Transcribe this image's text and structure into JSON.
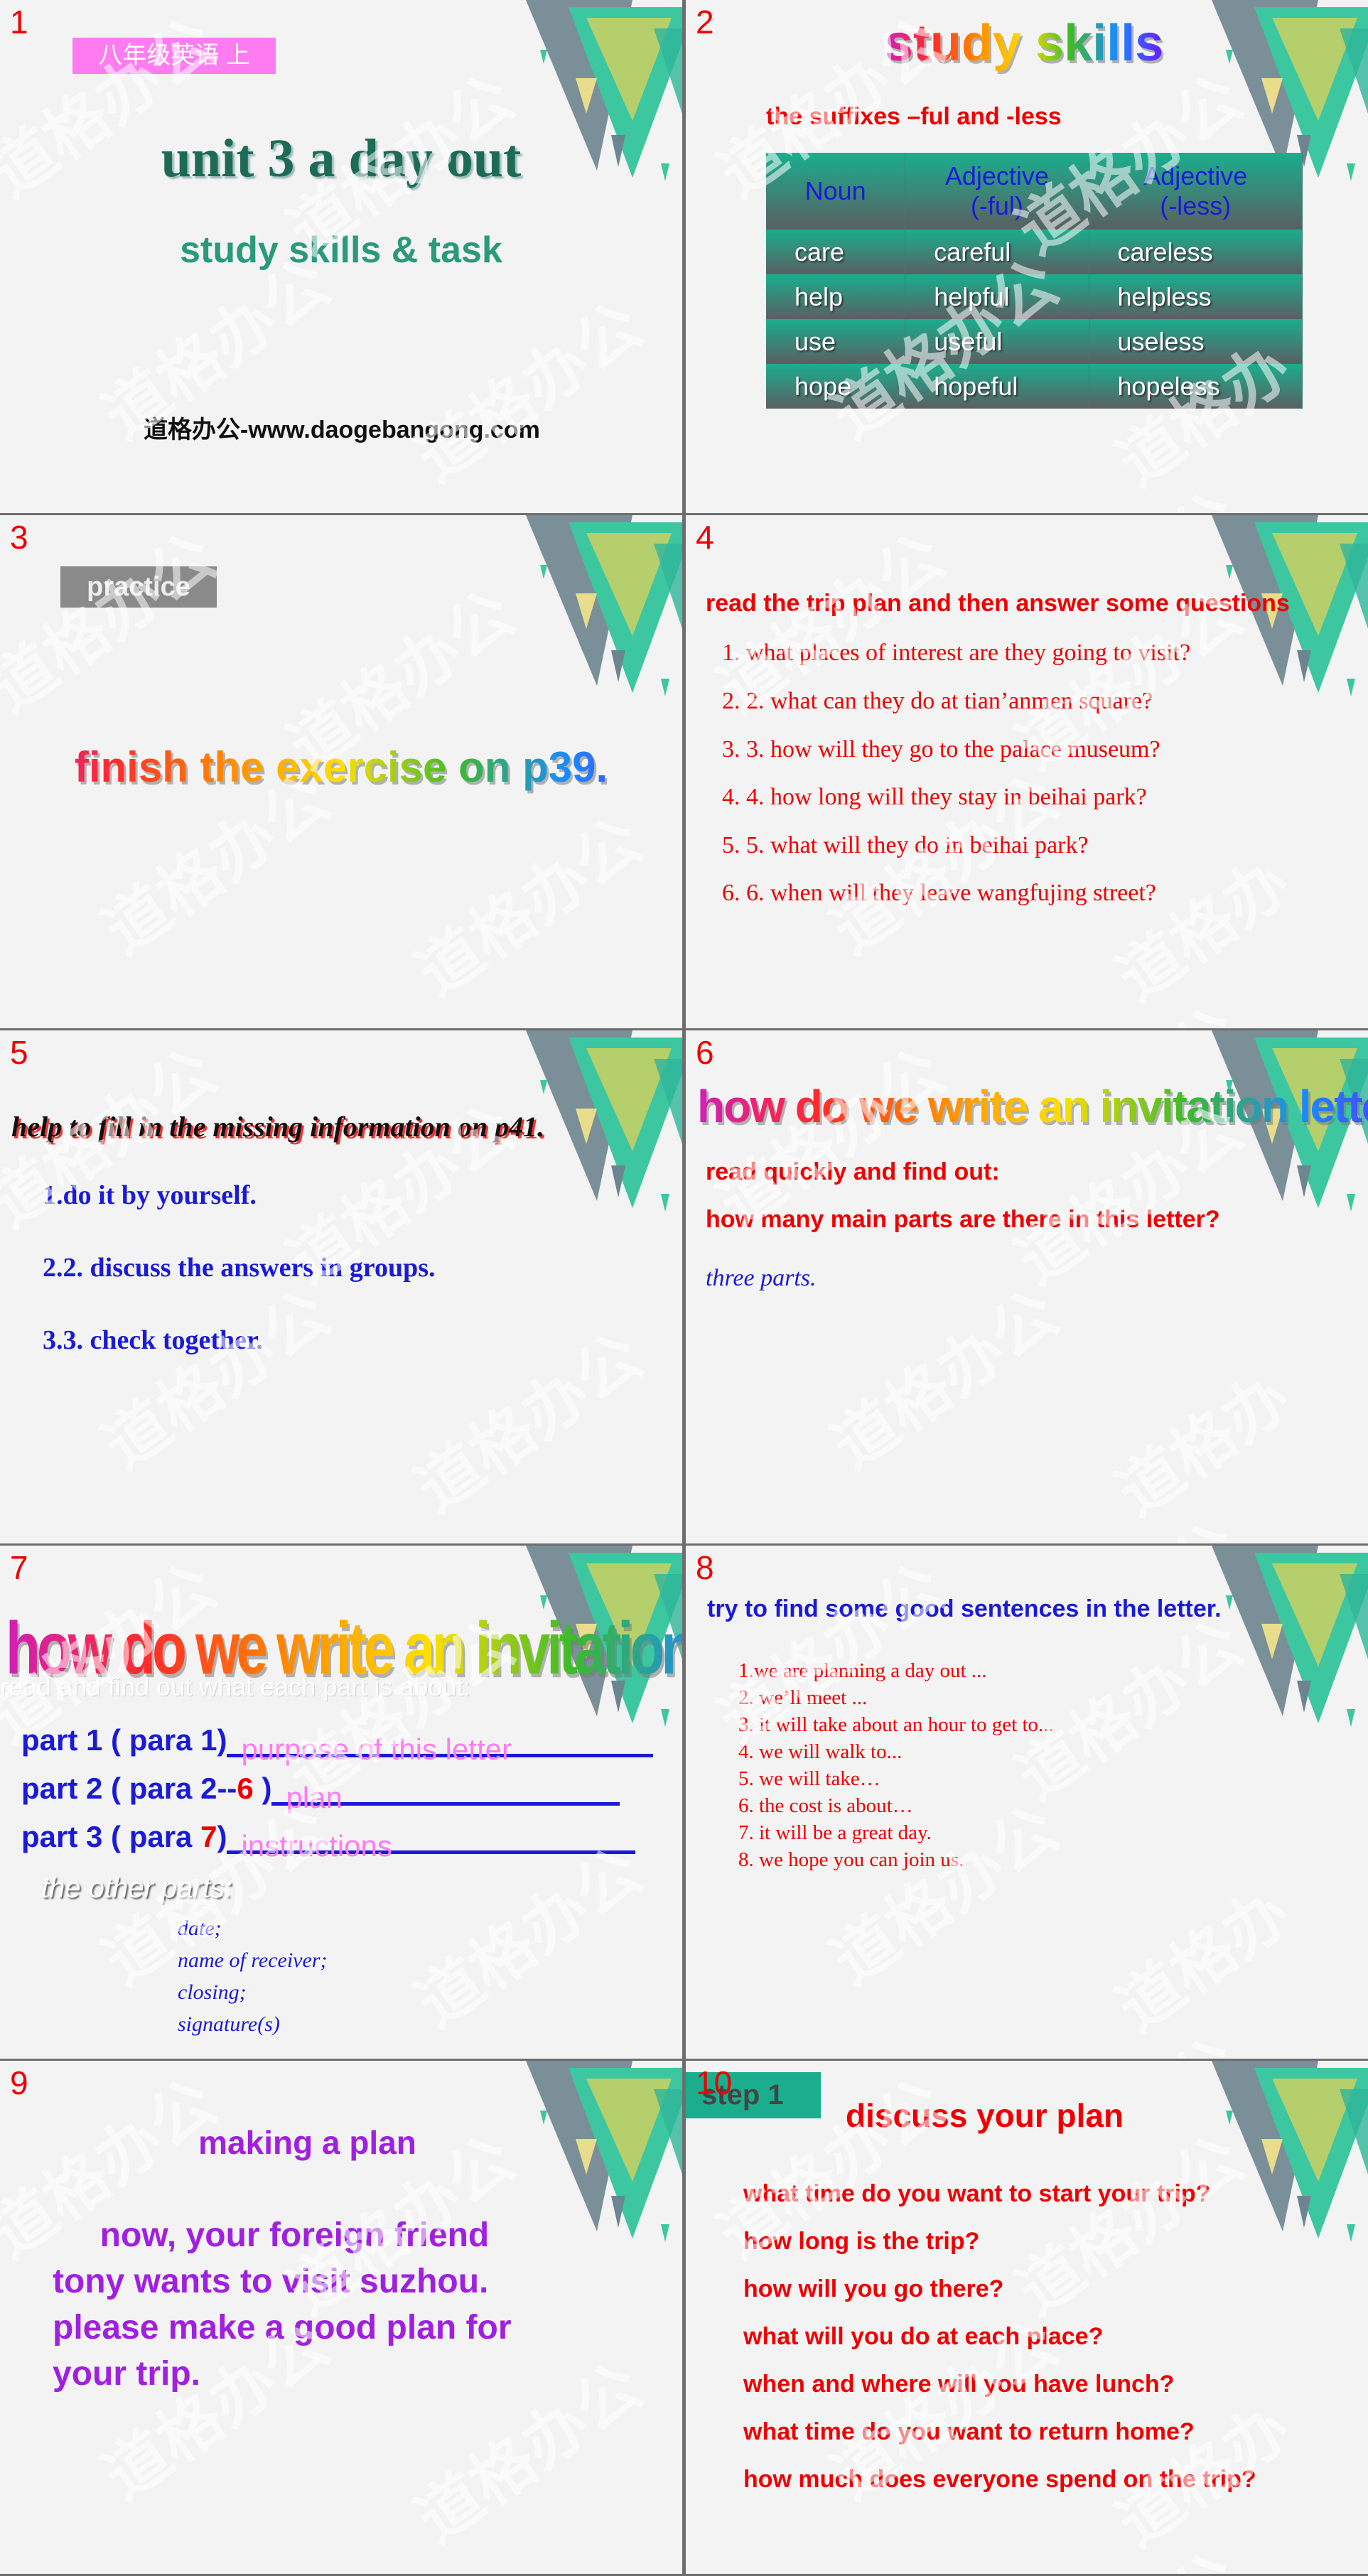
{
  "watermark": "道格办公",
  "colors": {
    "accent_teal": "#1aae8e",
    "slide_number": "#e00000",
    "title_green": "#1e6b55",
    "badge_pink": "#ff7bf0"
  },
  "slides": [
    {
      "number": "1",
      "badge": "八年级英语 上",
      "title": "unit 3  a day out",
      "subtitle": "study skills & task",
      "website": "道格办公-www.daogebangong.com"
    },
    {
      "number": "2",
      "title": "study skills",
      "subheading": "the suffixes –ful and -less",
      "table": {
        "headers": [
          [
            "Noun",
            ""
          ],
          [
            "Adjective",
            "(-ful)"
          ],
          [
            "Adjective",
            "(-less)"
          ]
        ],
        "rows": [
          [
            "care",
            "careful",
            "careless"
          ],
          [
            "help",
            "helpful",
            "helpless"
          ],
          [
            "use",
            "useful",
            "useless"
          ],
          [
            "hope",
            "hopeful",
            "hopeless"
          ]
        ]
      }
    },
    {
      "number": "3",
      "badge": "practice",
      "text": "finish the exercise on p39."
    },
    {
      "number": "4",
      "heading": "read the trip plan and then answer some questions",
      "questions": [
        "1. what places of interest are they going to visit?",
        "2. 2. what can they do at tian’anmen square?",
        "3. 3. how will they go to the palace museum?",
        "4. 4. how long will they stay in beihai park?",
        "5. 5. what will they do in beihai park?",
        "6.  6. when will they leave wangfujing street?"
      ]
    },
    {
      "number": "5",
      "heading": "help to fill in the missing information on p41.",
      "items": [
        "1.do it by yourself.",
        "2.2. discuss the answers in groups.",
        "3.3. check together."
      ]
    },
    {
      "number": "6",
      "title": "how do we write an invitation letter?",
      "lines": [
        "read quickly and find out:",
        "how many main parts are there in this letter?"
      ],
      "answer": "three parts."
    },
    {
      "number": "7",
      "title": "how do we write an invitation letter?",
      "instruction": "read  and find out what each part is about:",
      "parts": [
        {
          "label": "part 1 ( para 1)",
          "extra": "",
          "answer": "purpose of this letter"
        },
        {
          "label": "part 2 ( para 2--",
          "extra": "6",
          "close": " )",
          "answer": "plan"
        },
        {
          "label": "part 3 ( para ",
          "extra": "7",
          "close": ")",
          "answer": "instructions"
        }
      ],
      "other_heading": "the other parts:",
      "others": [
        "date;",
        "name of receiver;",
        "closing;",
        "signature(s)"
      ]
    },
    {
      "number": "8",
      "heading": "try to find some good sentences in the letter.",
      "sentences": [
        "1.we are planning a day out ...",
        "2. we’ll meet ...",
        "3. it will take about an hour to get to...",
        "4. we will walk to...",
        "5. we will take…",
        "6. the cost is about…",
        "7. it will be a great day.",
        "8. we hope you can join us."
      ]
    },
    {
      "number": "9",
      "title": "making a plan",
      "paragraph": [
        "     now, your foreign friend",
        "tony wants to visit suzhou.",
        "please make a good plan for",
        "your trip."
      ]
    },
    {
      "number": "10",
      "badge": "step 1",
      "title": "discuss your plan",
      "questions": [
        "what time do you want to start your trip?",
        "how long is the trip?",
        "how will you go there?",
        "what will you do at each place?",
        "when and where will you have lunch?",
        "what time do you want to return home?",
        "how much does everyone spend on the trip?"
      ]
    }
  ]
}
